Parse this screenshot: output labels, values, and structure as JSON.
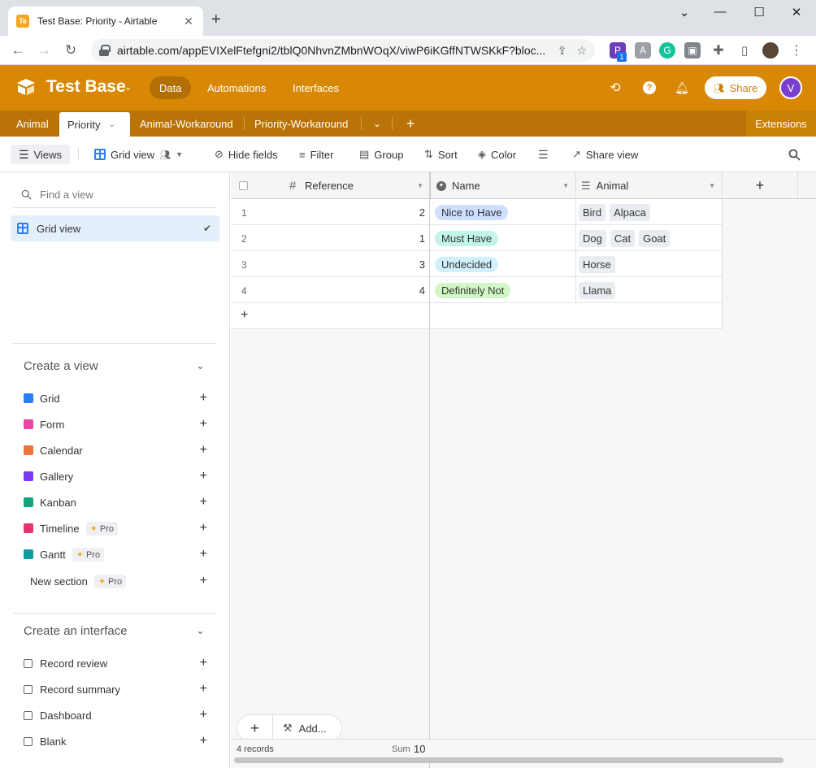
{
  "browser": {
    "tab_title": "Test Base: Priority - Airtable",
    "favicon_text": "Te",
    "url": "airtable.com/appEVIXelFtefgni2/tblQ0NhvnZMbnWOqX/viwP6iKGffNTWSKkF?bloc...",
    "ext_badge": "1"
  },
  "header": {
    "base_name": "Test Base",
    "nav": [
      "Data",
      "Automations",
      "Interfaces"
    ],
    "share_label": "Share",
    "avatar_letter": "V",
    "accent": "#d98806"
  },
  "tables": {
    "tabs": [
      "Animal",
      "Priority",
      "Animal-Workaround",
      "Priority-Workaround"
    ],
    "extensions": "Extensions"
  },
  "viewbar": {
    "views": "Views",
    "grid_view": "Grid view",
    "hide_fields": "Hide fields",
    "filter": "Filter",
    "group": "Group",
    "sort": "Sort",
    "color": "Color",
    "share_view": "Share view"
  },
  "sidebar": {
    "find_placeholder": "Find a view",
    "current_view": "Grid view",
    "create_view_title": "Create a view",
    "view_types": [
      {
        "label": "Grid",
        "color": "#2d7ff9"
      },
      {
        "label": "Form",
        "color": "#e7489f"
      },
      {
        "label": "Calendar",
        "color": "#f0743a"
      },
      {
        "label": "Gallery",
        "color": "#7c39ed"
      },
      {
        "label": "Kanban",
        "color": "#11a57e"
      },
      {
        "label": "Timeline",
        "color": "#e5346b",
        "pro": "Pro"
      },
      {
        "label": "Gantt",
        "color": "#0d9ba0",
        "pro": "Pro"
      }
    ],
    "new_section": "New section",
    "new_section_pro": "Pro",
    "create_interface_title": "Create an interface",
    "interface_types": [
      "Record review",
      "Record summary",
      "Dashboard",
      "Blank"
    ]
  },
  "grid": {
    "columns": [
      "Reference",
      "Name",
      "Animal"
    ],
    "rows": [
      {
        "num": "1",
        "reference": "2",
        "name": "Nice to Have",
        "name_color": "#cfdfff",
        "animals": [
          "Bird",
          "Alpaca"
        ]
      },
      {
        "num": "2",
        "reference": "1",
        "name": "Must Have",
        "name_color": "#c2f5e9",
        "animals": [
          "Dog",
          "Cat",
          "Goat"
        ]
      },
      {
        "num": "3",
        "reference": "3",
        "name": "Undecided",
        "name_color": "#d0f0fd",
        "animals": [
          "Horse"
        ]
      },
      {
        "num": "4",
        "reference": "4",
        "name": "Definitely Not",
        "name_color": "#d1f7c4",
        "animals": [
          "Llama"
        ]
      }
    ],
    "add_label": "Add...",
    "record_count": "4 records",
    "sum_label": "Sum",
    "sum_value": "10"
  }
}
